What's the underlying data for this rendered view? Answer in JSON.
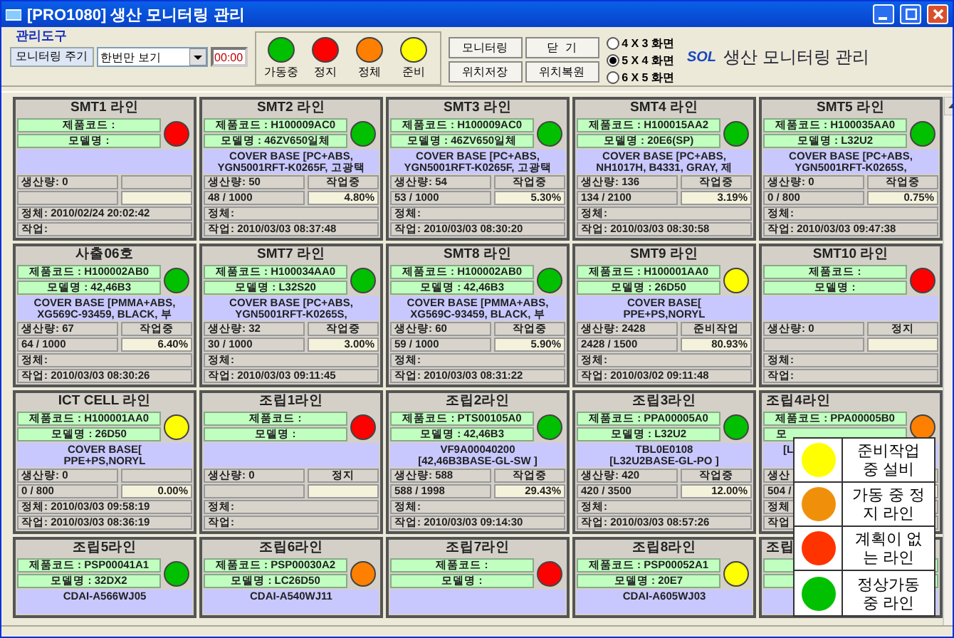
{
  "window": {
    "title": "[PRO1080] 생산 모니터링 관리"
  },
  "toolbar": {
    "group_label": "관리도구",
    "cycle_button": "모니터링 주기",
    "cycle_select": "한번만 보기",
    "timer": "00:00",
    "status_legend": [
      {
        "label": "가동중",
        "color": "#00c000"
      },
      {
        "label": "정지",
        "color": "#ff0000"
      },
      {
        "label": "정체",
        "color": "#ff8000"
      },
      {
        "label": "준비",
        "color": "#ffff00"
      }
    ],
    "buttons": [
      "모니터링",
      "닫  기",
      "위치저장",
      "위치복원"
    ],
    "display_modes": [
      {
        "label": "4 X 3 화면",
        "selected": false
      },
      {
        "label": "5 X 4 화면",
        "selected": true
      },
      {
        "label": "6 X 5 화면",
        "selected": false
      }
    ],
    "logo": "SOL",
    "app_title": "생산 모니터링 관리"
  },
  "lines": [
    {
      "title": "SMT1 라인",
      "code": "제품코드 :",
      "model": "모델명 :",
      "color": "#ff0000",
      "stats": {
        "production": "생산량: 0",
        "stall": "정체: 2010/02/24 20:02:42",
        "work": "작업:"
      }
    },
    {
      "title": "SMT2 라인",
      "code": "제품코드 : H100009AC0",
      "model": "모델명 : 46ZV650일체",
      "color": "#00c000",
      "desc": [
        "COVER BASE [PC+ABS,",
        "YGN5001RFT-K0265F, 고광택"
      ],
      "stats": {
        "production": "생산량: 50",
        "state": "작업중",
        "count": "48 / 1000",
        "percent": "4.80%",
        "stall": "정체:",
        "work": "작업: 2010/03/03 08:37:48"
      }
    },
    {
      "title": "SMT3 라인",
      "code": "제품코드 : H100009AC0",
      "model": "모델명 : 46ZV650일체",
      "color": "#00c000",
      "desc": [
        "COVER BASE [PC+ABS,",
        "YGN5001RFT-K0265F, 고광택"
      ],
      "stats": {
        "production": "생산량: 54",
        "state": "작업중",
        "count": "53 / 1000",
        "percent": "5.30%",
        "stall": "정체:",
        "work": "작업: 2010/03/03 08:30:20"
      }
    },
    {
      "title": "SMT4 라인",
      "code": "제품코드 : H100015AA2",
      "model": "모델명 : 20E6(SP)",
      "color": "#00c000",
      "desc": [
        "COVER BASE [PC+ABS,",
        "NH1017H, B4331, GRAY, 제"
      ],
      "stats": {
        "production": "생산량: 136",
        "state": "작업중",
        "count": "134 / 2100",
        "percent": "3.19%",
        "stall": "정체:",
        "work": "작업: 2010/03/03 08:30:58"
      }
    },
    {
      "title": "SMT5 라인",
      "code": "제품코드 : H100035AA0",
      "model": "모델명 : L32U2",
      "color": "#00c000",
      "desc": [
        "COVER BASE [PC+ABS,",
        "YGN5001RFT-K0265S,"
      ],
      "stats": {
        "production": "생산량: 0",
        "state": "작업중",
        "count": "0 / 800",
        "percent": "0.75%",
        "stall": "정체:",
        "work": "작업: 2010/03/03 09:47:38"
      }
    },
    {
      "title": "사출06호",
      "code": "제품코드 : H100002AB0",
      "model": "모델명 : 42,46B3",
      "color": "#00c000",
      "desc": [
        "COVER BASE [PMMA+ABS,",
        "XG569C-93459, BLACK, 부"
      ],
      "stats": {
        "production": "생산량: 67",
        "state": "작업중",
        "count": "64 / 1000",
        "percent": "6.40%",
        "stall": "정체:",
        "work": "작업: 2010/03/03 08:30:26"
      }
    },
    {
      "title": "SMT7 라인",
      "code": "제품코드 : H100034AA0",
      "model": "모델명 : L32S20",
      "color": "#00c000",
      "desc": [
        "COVER BASE [PC+ABS,",
        "YGN5001RFT-K0265S,"
      ],
      "stats": {
        "production": "생산량: 32",
        "state": "작업중",
        "count": "30 / 1000",
        "percent": "3.00%",
        "stall": "정체:",
        "work": "작업: 2010/03/03 09:11:45"
      }
    },
    {
      "title": "SMT8 라인",
      "code": "제품코드 : H100002AB0",
      "model": "모델명 : 42,46B3",
      "color": "#00c000",
      "desc": [
        "COVER BASE [PMMA+ABS,",
        "XG569C-93459, BLACK, 부"
      ],
      "stats": {
        "production": "생산량: 60",
        "state": "작업중",
        "count": "59 / 1000",
        "percent": "5.90%",
        "stall": "정체:",
        "work": "작업: 2010/03/03 08:31:22"
      }
    },
    {
      "title": "SMT9 라인",
      "code": "제품코드 : H100001AA0",
      "model": "모델명 : 26D50",
      "color": "#ffff00",
      "desc": [
        "COVER BASE[",
        "PPE+PS,NORYL"
      ],
      "stats": {
        "production": "생산량: 2428",
        "state": "준비작업",
        "count": "2428 / 1500",
        "percent": "80.93%",
        "stall": "정체:",
        "work": "작업: 2010/03/02 09:11:48"
      }
    },
    {
      "title": "SMT10 라인",
      "code": "제품코드 :",
      "model": "모델명 :",
      "color": "#ff0000",
      "stats": {
        "production": "생산량: 0",
        "state": "정지",
        "stall": "정체:",
        "work": "작업:"
      }
    },
    {
      "title": "ICT CELL 라인",
      "code": "제품코드 : H100001AA0",
      "model": "모델명 : 26D50",
      "color": "#ffff00",
      "desc": [
        "COVER BASE[",
        "PPE+PS,NORYL"
      ],
      "stats": {
        "production": "생산량: 0",
        "count": "0 / 800",
        "percent": "0.00%",
        "stall": "정체: 2010/03/03 09:58:19",
        "work": "작업: 2010/03/03 08:36:19"
      }
    },
    {
      "title": "조립1라인",
      "code": "제품코드 :",
      "model": "모델명 :",
      "color": "#ff0000",
      "stats": {
        "production": "생산량: 0",
        "state": "정지",
        "stall": "정체:",
        "work": "작업:"
      }
    },
    {
      "title": "조립2라인",
      "code": "제품코드 : PTS00105A0",
      "model": "모델명 : 42,46B3",
      "color": "#00c000",
      "desc": [
        "VF9A00040200",
        "[42,46B3BASE-GL-SW ]"
      ],
      "stats": {
        "production": "생산량: 588",
        "state": "작업중",
        "count": "588 / 1998",
        "percent": "29.43%",
        "stall": "정체:",
        "work": "작업: 2010/03/03 09:14:30"
      }
    },
    {
      "title": "조립3라인",
      "code": "제품코드 : PPA00005A0",
      "model": "모델명 : L32U2",
      "color": "#00c000",
      "desc": [
        "TBL0E0108",
        "[L32U2BASE-GL-PO ]"
      ],
      "stats": {
        "production": "생산량: 420",
        "state": "작업중",
        "count": "420 / 3500",
        "percent": "12.00%",
        "stall": "정체:",
        "work": "작업: 2010/03/03 08:57:26"
      }
    },
    {
      "title": "조립4라인",
      "covered": true,
      "code": "제품코드 : PPA00005B0",
      "model": "모",
      "color": "#ff8000",
      "desc": [
        "[L"
      ],
      "stats": {
        "production": "생산",
        "count": "504 /",
        "stall": "정체",
        "work": "작업"
      }
    },
    {
      "title": "조립5라인",
      "code": "제품코드 : PSP00041A1",
      "model": "모델명 : 32DX2",
      "color": "#00c000",
      "desc": [
        "CDAI-A566WJ05"
      ]
    },
    {
      "title": "조립6라인",
      "code": "제품코드 : PSP00030A2",
      "model": "모델명 : LC26D50",
      "color": "#ff8000",
      "desc": [
        "CDAI-A540WJ11"
      ]
    },
    {
      "title": "조립7라인",
      "code": "제품코드 :",
      "model": "모델명 :",
      "color": "#ff0000"
    },
    {
      "title": "조립8라인",
      "code": "제품코드 : PSP00052A1",
      "model": "모델명 : 20E7",
      "color": "#ffff00",
      "desc": [
        "CDAI-A605WJ03"
      ]
    },
    {
      "title": "조립",
      "covered": true
    }
  ],
  "legend": [
    {
      "label": "준비작업 중 설비",
      "color": "#ffff00"
    },
    {
      "label": "가동 중 정지 라인",
      "color": "#f0900a"
    },
    {
      "label": "계획이 없는 라인",
      "color": "#ff3300"
    },
    {
      "label": "정상가동 중 라인",
      "color": "#00c000"
    }
  ]
}
